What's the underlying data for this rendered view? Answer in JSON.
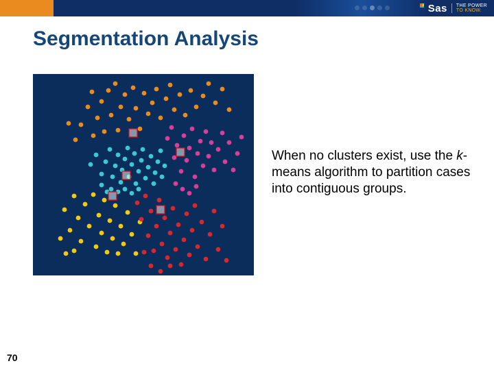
{
  "brand": {
    "name": "Sas",
    "tag1": "THE POWER",
    "tag2": "TO KNOW."
  },
  "title": "Segmentation Analysis",
  "body": {
    "line1": "When no clusters exist, use the ",
    "kmeans": "k",
    "line2": "-means algorithm to partition cases into contiguous groups."
  },
  "page": "70",
  "chart_data": {
    "type": "scatter",
    "title": "k-means cluster scatter",
    "xlabel": "",
    "ylabel": "",
    "xlim": [
      0,
      322
    ],
    "ylim": [
      0,
      294
    ],
    "colors": {
      "orange": "#e98b1f",
      "cyan": "#3cc9d6",
      "magenta": "#d83f9b",
      "yellow": "#f2cc0c",
      "red": "#d8272d"
    },
    "seeds": [
      {
        "x": 146,
        "y": 86,
        "cluster": "orange"
      },
      {
        "x": 215,
        "y": 114,
        "cluster": "magenta"
      },
      {
        "x": 136,
        "y": 148,
        "cluster": "cyan"
      },
      {
        "x": 116,
        "y": 178,
        "cluster": "yellow"
      },
      {
        "x": 186,
        "y": 198,
        "cluster": "red"
      }
    ],
    "series": [
      {
        "name": "orange",
        "points": [
          [
            52,
            72
          ],
          [
            62,
            96
          ],
          [
            70,
            74
          ],
          [
            80,
            48
          ],
          [
            86,
            26
          ],
          [
            88,
            90
          ],
          [
            94,
            64
          ],
          [
            100,
            40
          ],
          [
            104,
            84
          ],
          [
            110,
            24
          ],
          [
            114,
            60
          ],
          [
            120,
            14
          ],
          [
            124,
            82
          ],
          [
            128,
            48
          ],
          [
            134,
            30
          ],
          [
            140,
            66
          ],
          [
            146,
            20
          ],
          [
            150,
            50
          ],
          [
            156,
            80
          ],
          [
            162,
            28
          ],
          [
            168,
            58
          ],
          [
            174,
            42
          ],
          [
            180,
            22
          ],
          [
            186,
            64
          ],
          [
            194,
            36
          ],
          [
            200,
            16
          ],
          [
            206,
            52
          ],
          [
            214,
            30
          ],
          [
            222,
            60
          ],
          [
            230,
            24
          ],
          [
            238,
            48
          ],
          [
            248,
            32
          ],
          [
            256,
            14
          ],
          [
            266,
            42
          ],
          [
            276,
            22
          ],
          [
            286,
            52
          ]
        ]
      },
      {
        "name": "cyan",
        "points": [
          [
            84,
            132
          ],
          [
            92,
            118
          ],
          [
            100,
            146
          ],
          [
            106,
            128
          ],
          [
            112,
            110
          ],
          [
            116,
            150
          ],
          [
            120,
            134
          ],
          [
            124,
            118
          ],
          [
            128,
            158
          ],
          [
            130,
            140
          ],
          [
            134,
            124
          ],
          [
            138,
            108
          ],
          [
            140,
            150
          ],
          [
            144,
            132
          ],
          [
            148,
            116
          ],
          [
            150,
            160
          ],
          [
            154,
            142
          ],
          [
            158,
            126
          ],
          [
            160,
            110
          ],
          [
            164,
            152
          ],
          [
            168,
            136
          ],
          [
            172,
            120
          ],
          [
            176,
            160
          ],
          [
            178,
            144
          ],
          [
            182,
            128
          ],
          [
            186,
            112
          ],
          [
            188,
            150
          ],
          [
            192,
            134
          ],
          [
            114,
            168
          ],
          [
            124,
            172
          ],
          [
            134,
            168
          ],
          [
            144,
            174
          ],
          [
            154,
            168
          ],
          [
            100,
            162
          ],
          [
            108,
            172
          ]
        ]
      },
      {
        "name": "magenta",
        "points": [
          [
            196,
            94
          ],
          [
            202,
            78
          ],
          [
            206,
            122
          ],
          [
            210,
            104
          ],
          [
            216,
            142
          ],
          [
            220,
            90
          ],
          [
            224,
            126
          ],
          [
            228,
            108
          ],
          [
            232,
            80
          ],
          [
            236,
            150
          ],
          [
            240,
            116
          ],
          [
            244,
            98
          ],
          [
            248,
            134
          ],
          [
            252,
            84
          ],
          [
            256,
            120
          ],
          [
            260,
            100
          ],
          [
            264,
            140
          ],
          [
            270,
            110
          ],
          [
            276,
            86
          ],
          [
            280,
            128
          ],
          [
            286,
            100
          ],
          [
            292,
            140
          ],
          [
            298,
            116
          ],
          [
            304,
            92
          ],
          [
            208,
            160
          ],
          [
            218,
            168
          ],
          [
            228,
            174
          ],
          [
            238,
            164
          ]
        ]
      },
      {
        "name": "yellow",
        "points": [
          [
            46,
            198
          ],
          [
            54,
            228
          ],
          [
            60,
            178
          ],
          [
            66,
            210
          ],
          [
            70,
            244
          ],
          [
            76,
            190
          ],
          [
            82,
            222
          ],
          [
            88,
            176
          ],
          [
            92,
            252
          ],
          [
            96,
            206
          ],
          [
            100,
            232
          ],
          [
            104,
            184
          ],
          [
            108,
            260
          ],
          [
            112,
            214
          ],
          [
            116,
            240
          ],
          [
            120,
            192
          ],
          [
            124,
            262
          ],
          [
            128,
            222
          ],
          [
            132,
            248
          ],
          [
            138,
            202
          ],
          [
            144,
            234
          ],
          [
            150,
            262
          ],
          [
            156,
            216
          ],
          [
            40,
            240
          ],
          [
            48,
            262
          ],
          [
            60,
            258
          ]
        ]
      },
      {
        "name": "red",
        "points": [
          [
            152,
            188
          ],
          [
            158,
            212
          ],
          [
            164,
            178
          ],
          [
            168,
            236
          ],
          [
            172,
            200
          ],
          [
            176,
            258
          ],
          [
            180,
            222
          ],
          [
            184,
            184
          ],
          [
            188,
            248
          ],
          [
            192,
            210
          ],
          [
            196,
            268
          ],
          [
            200,
            232
          ],
          [
            204,
            196
          ],
          [
            208,
            256
          ],
          [
            212,
            220
          ],
          [
            216,
            278
          ],
          [
            220,
            242
          ],
          [
            224,
            204
          ],
          [
            228,
            264
          ],
          [
            232,
            228
          ],
          [
            236,
            192
          ],
          [
            240,
            252
          ],
          [
            246,
            216
          ],
          [
            252,
            270
          ],
          [
            258,
            234
          ],
          [
            264,
            200
          ],
          [
            270,
            256
          ],
          [
            276,
            222
          ],
          [
            282,
            272
          ],
          [
            162,
            260
          ],
          [
            172,
            280
          ],
          [
            186,
            288
          ],
          [
            200,
            280
          ]
        ]
      }
    ]
  }
}
